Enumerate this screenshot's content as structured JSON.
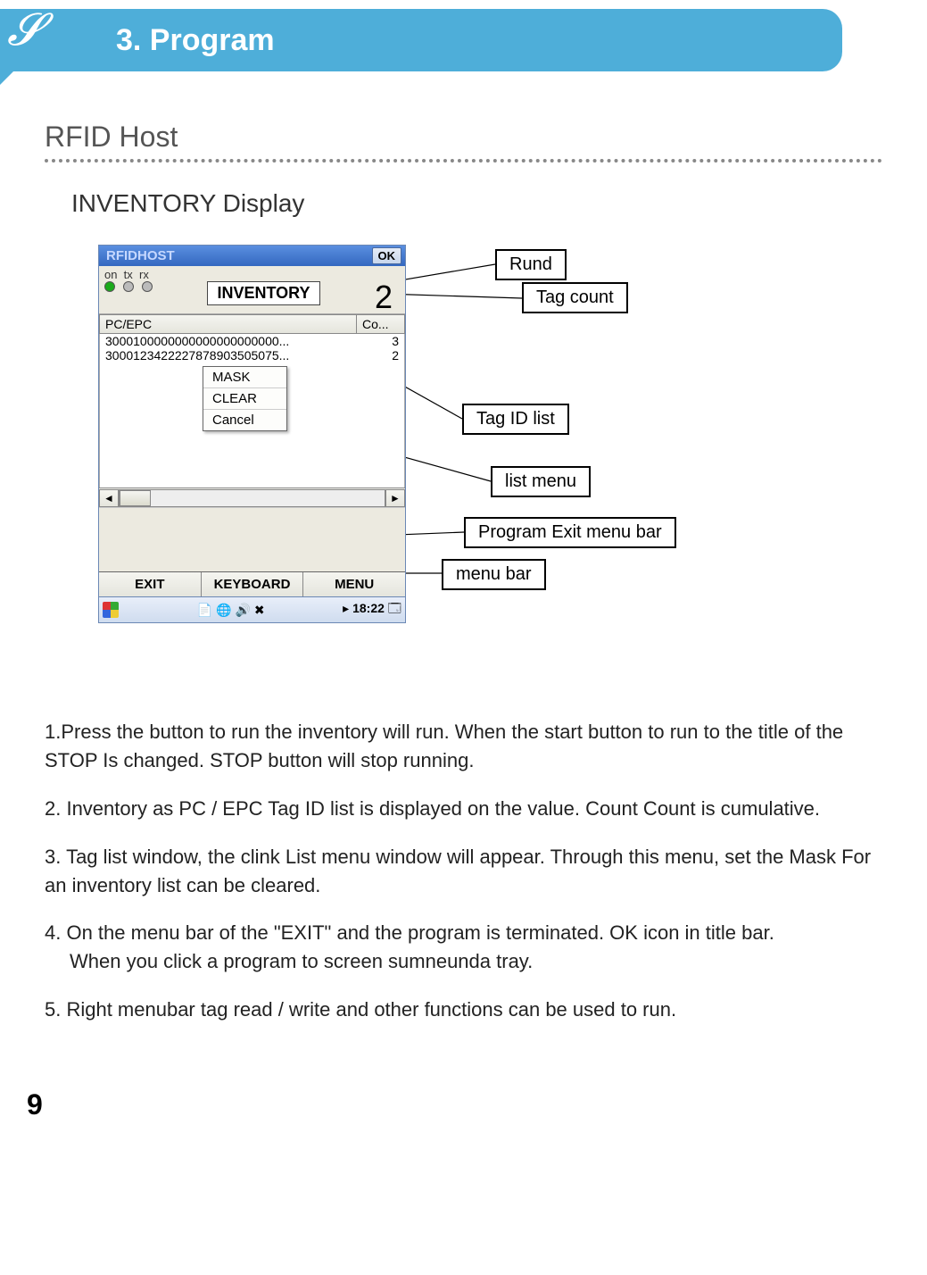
{
  "header": {
    "title": "3. Program"
  },
  "section": {
    "title": "RFID Host"
  },
  "subsection": {
    "title": "INVENTORY Display"
  },
  "device": {
    "title": "RFIDHOST",
    "ok": "OK",
    "status_labels": "on  tx  rx",
    "inventory_btn": "INVENTORY",
    "tag_count": "2",
    "list": {
      "col1": "PC/EPC",
      "col2": "Co...",
      "rows": [
        {
          "id": "3000100000000000000000000...",
          "count": "3"
        },
        {
          "id": "3000123422227878903505075...",
          "count": "2"
        }
      ]
    },
    "context_menu": {
      "items": [
        "MASK",
        "CLEAR",
        "Cancel"
      ]
    },
    "menubar": {
      "items": [
        "EXIT",
        "KEYBOARD",
        "MENU"
      ]
    },
    "taskbar": {
      "time": "18:22",
      "arrow": "▸"
    }
  },
  "callouts": {
    "rund": "Rund",
    "tag_count": "Tag count",
    "tag_id_list": "Tag ID list",
    "list_menu": "list menu",
    "program_exit": "Program Exit menu bar",
    "menu_bar": "menu bar"
  },
  "body": {
    "p1": "1.Press the button to run the inventory will run. When the start button to run to the title of the STOP Is changed. STOP button will stop running.",
    "p2": "2. Inventory as PC / EPC Tag ID list is displayed on the value. Count Count is cumulative.",
    "p3": "3. Tag list window, the clink List menu window will appear. Through this menu, set the Mask For an inventory list can be cleared.",
    "p4a": "4. On the menu bar of the \"EXIT\" and the program is terminated. OK icon in title bar.",
    "p4b": "When you click a program to screen sumneunda tray.",
    "p5": "5. Right menubar tag read / write and other functions can be used to run."
  },
  "page_number": "9"
}
